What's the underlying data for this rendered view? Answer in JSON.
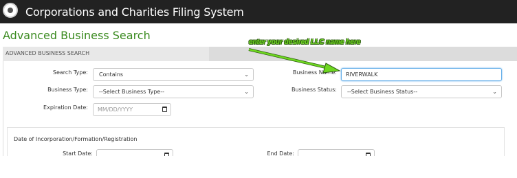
{
  "header": {
    "app_title": "Corporations and Charities Filing System",
    "logo_icon": "state-seal-icon"
  },
  "page": {
    "title": "Advanced Business Search",
    "section_label": "ADVANCED BUSINESS SEARCH"
  },
  "form": {
    "search_type_label": "Search Type:",
    "search_type_value": "Contains",
    "business_type_label": "Business Type:",
    "business_type_value": "--Select Business Type--",
    "expiration_date_label": "Expiration Date:",
    "expiration_date_placeholder": "MM/DD/YYYY",
    "business_name_label": "Business Name:",
    "business_name_value": "RIVERWALK",
    "business_status_label": "Business Status:",
    "business_status_value": "--Select Business Status--"
  },
  "date_section": {
    "title": "Date of Incorporation/Formation/Registration",
    "start_date_label": "Start Date:",
    "end_date_label": "End Date:"
  },
  "annotation": {
    "text": "enter your desired LLC name here",
    "color": "#6ed820"
  }
}
